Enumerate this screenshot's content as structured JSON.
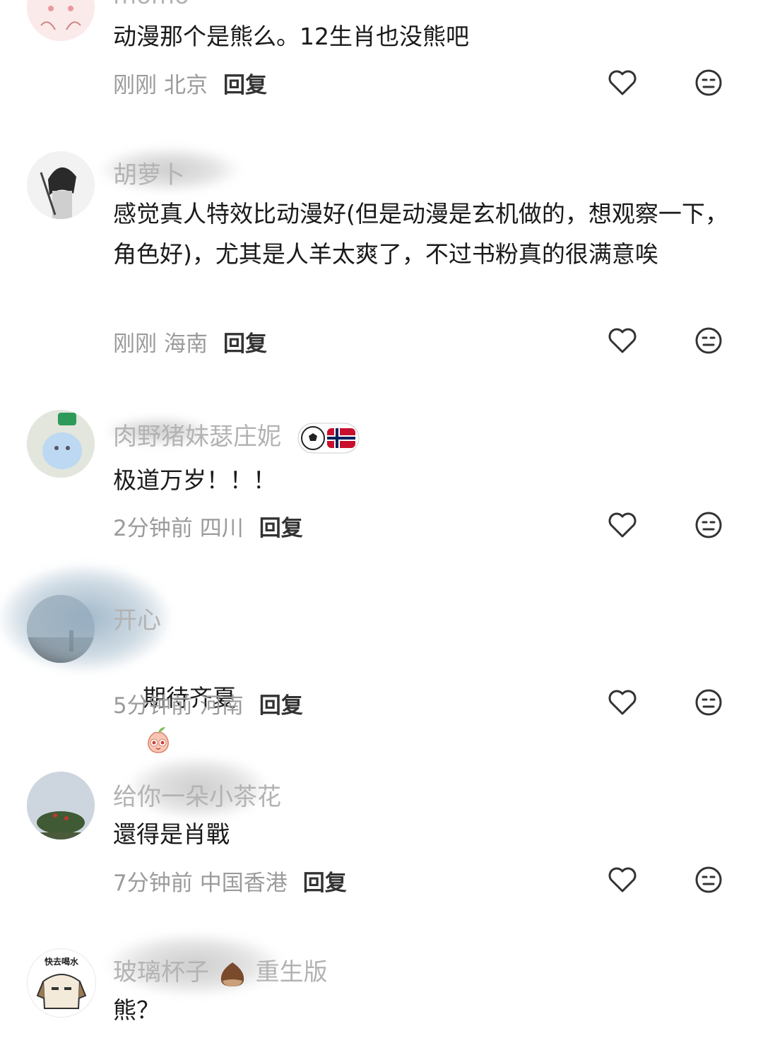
{
  "comments": [
    {
      "name": "momo",
      "text": "动漫那个是熊么。12生肖也没熊吧",
      "time": "刚刚",
      "location": "北京",
      "reply": "回复"
    },
    {
      "name": "胡萝卜",
      "text": "感觉真人特效比动漫好(但是动漫是玄机做的，想观察一下，角色好)，尤其是人羊太爽了，不过书粉真的很满意唉",
      "time": "刚刚",
      "location": "海南",
      "reply": "回复"
    },
    {
      "name": "肉野猪妹瑟庄妮",
      "text": "极道万岁！！！",
      "time": "2分钟前",
      "location": "四川",
      "reply": "回复"
    },
    {
      "name": "开心",
      "text": "期待齐夏",
      "time": "5分钟前",
      "location": "河南",
      "reply": "回复"
    },
    {
      "name": "给你一朵小茶花",
      "text": "還得是肖戰",
      "time": "7分钟前",
      "location": "中国香港",
      "reply": "回复"
    },
    {
      "name": "玻璃杯子",
      "name_suffix": "重生版",
      "text": "熊？",
      "avatar_caption": "快去喝水"
    }
  ],
  "icons": {
    "like": "heart-outline-icon",
    "dislike": "neutral-face-icon"
  },
  "colors": {
    "username": "#b3b3b3",
    "meta": "#9b9b9b",
    "body_text": "#1a1a1a",
    "reply": "#333333",
    "icon_stroke": "#333333"
  }
}
